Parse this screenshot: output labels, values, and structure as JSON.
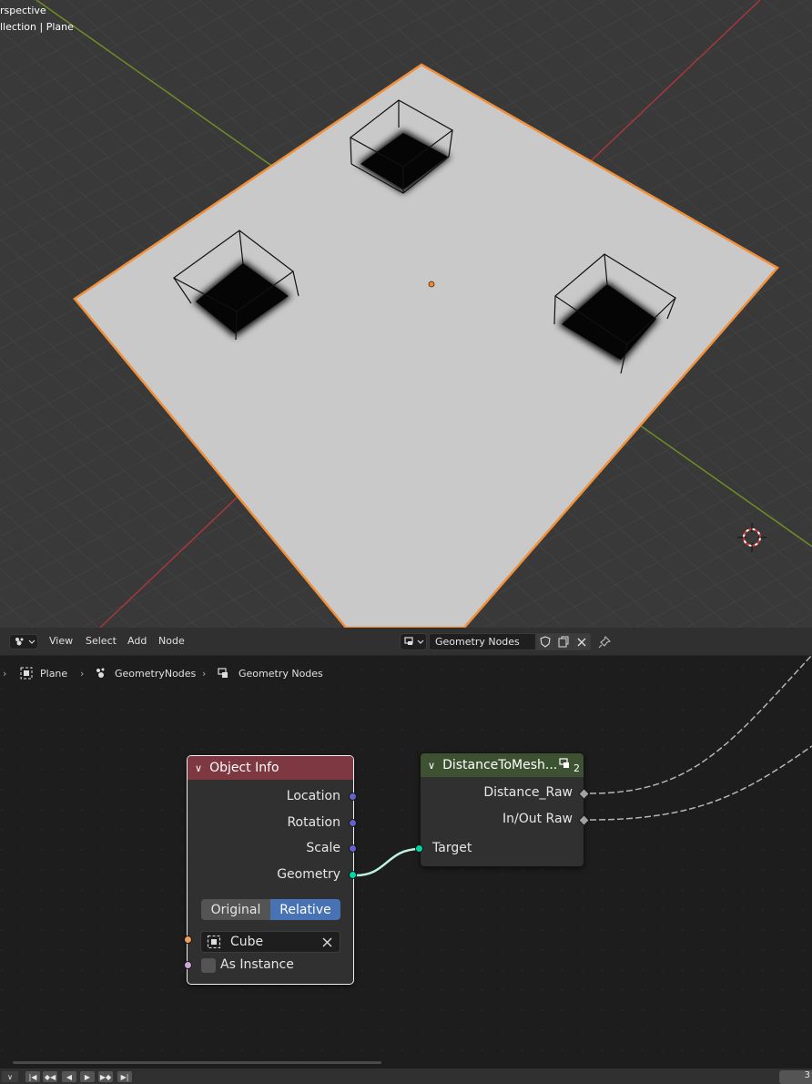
{
  "viewport": {
    "line1": "rspective",
    "line2": "llection | Plane"
  },
  "header": {
    "menus": [
      "View",
      "Select",
      "Add",
      "Node"
    ],
    "node_tree_name": "Geometry Nodes",
    "editor_icon": "node-editor-icon",
    "pin_icon": "pin-icon"
  },
  "breadcrumb": {
    "object": "Plane",
    "modifier": "GeometryNodes",
    "tree": "Geometry Nodes"
  },
  "nodes": {
    "object_info": {
      "title": "Object Info",
      "header_color": "#7d3841",
      "outputs": [
        "Location",
        "Rotation",
        "Scale",
        "Geometry"
      ],
      "transform_space": {
        "options": [
          "Original",
          "Relative"
        ],
        "selected": "Relative"
      },
      "object_value": "Cube",
      "as_instance_label": "As Instance",
      "as_instance_checked": false
    },
    "distance_to_mesh": {
      "title": "DistanceToMesh...",
      "header_color": "#3c5230",
      "user_count": "2",
      "outputs": [
        "Distance_Raw",
        "In/Out Raw"
      ],
      "inputs": [
        "Target"
      ]
    }
  },
  "socket_colors": {
    "vector": "#6363c7",
    "geometry": "#00d6a3",
    "object": "#ed9e5c",
    "boolean": "#cca6d6",
    "float": "#a1a1a1"
  },
  "timeline": {
    "frame": "3"
  }
}
